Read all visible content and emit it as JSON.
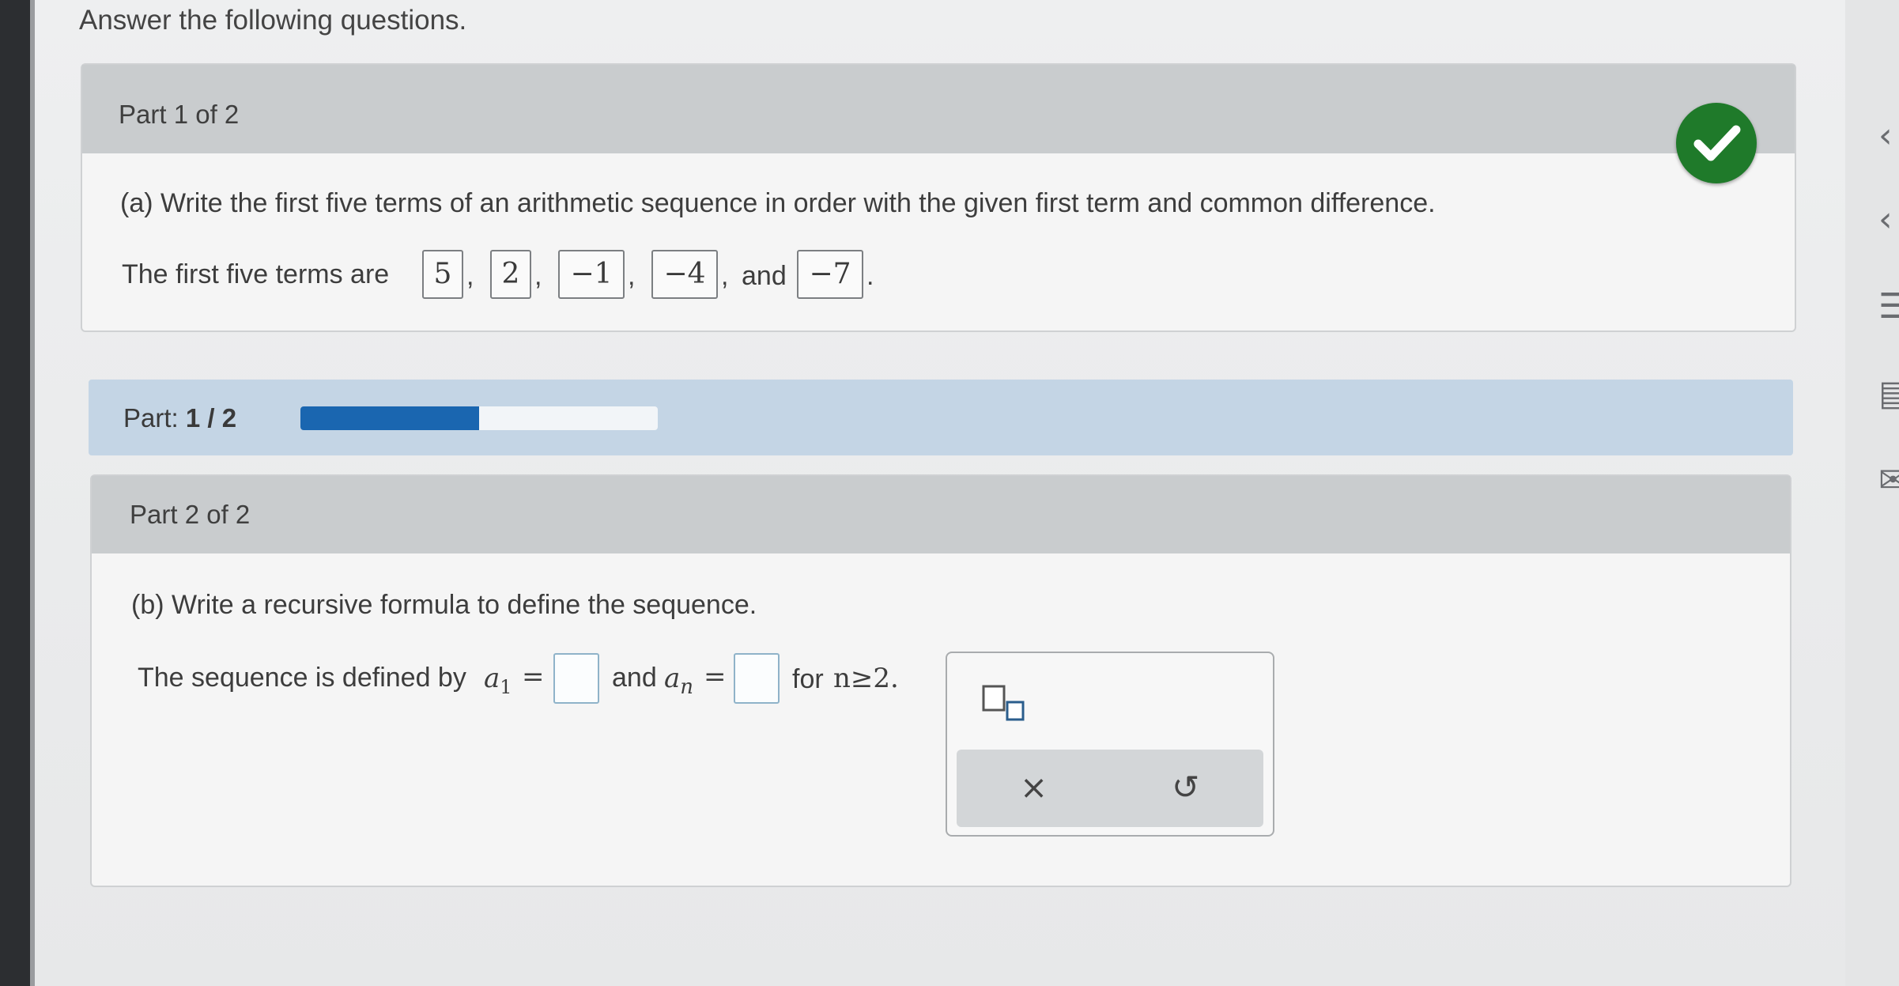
{
  "instructions": "Answer the following questions.",
  "part1": {
    "title": "Part 1 of 2",
    "question": "(a) Write the first five terms of an arithmetic sequence in order with the given first term and common difference.",
    "lead": "The first five terms are",
    "answers": [
      "5",
      "2",
      "−1",
      "−4",
      "−7"
    ],
    "comma": ",",
    "and": "and",
    "period": ".",
    "status_icon": "checkmark-icon",
    "status_color": "#1f7a2a"
  },
  "progress": {
    "label": "Part:",
    "value": "1 / 2",
    "fraction": 0.5,
    "fill_color": "#1a66b0"
  },
  "part2": {
    "title": "Part 2 of 2",
    "question": "(b) Write a recursive formula to define the sequence.",
    "lead": "The sequence is defined by",
    "a1_var": "a",
    "a1_sub": "1",
    "equals": "=",
    "and": "and",
    "an_var": "a",
    "an_sub": "n",
    "for_text": "for",
    "condition": "n≥2."
  },
  "palette": {
    "tool_icon": "subscript-template-icon",
    "clear_icon": "×",
    "undo_icon": "↺"
  },
  "right_rail_icons": [
    "collapse-icon",
    "back-icon",
    "calculator-icon",
    "reference-icon",
    "mail-icon"
  ]
}
